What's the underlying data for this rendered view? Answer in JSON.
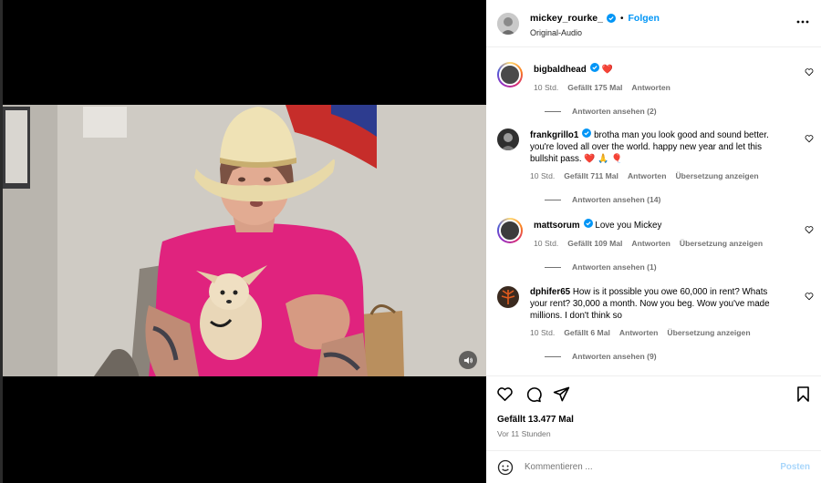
{
  "post": {
    "username": "mickey_rourke_",
    "separator": "•",
    "follow_label": "Folgen",
    "audio": "Original-Audio"
  },
  "comments": [
    {
      "username": "bigbaldhead",
      "text": "",
      "emoji": "❤️",
      "age": "10 Std.",
      "likes": "Gefällt 175 Mal",
      "reply": "Antworten",
      "translate": "",
      "view_replies": "Antworten ansehen (2)"
    },
    {
      "username": "frankgrillo1",
      "text": "brotha man you look good and sound better. you're loved all over the world. happy new year and let this bullshit pass.",
      "emoji": "❤️ 🙏 🎈",
      "age": "10 Std.",
      "likes": "Gefällt 711 Mal",
      "reply": "Antworten",
      "translate": "Übersetzung anzeigen",
      "view_replies": "Antworten ansehen (14)"
    },
    {
      "username": "mattsorum",
      "text": "Love you Mickey",
      "emoji": "",
      "age": "10 Std.",
      "likes": "Gefällt 109 Mal",
      "reply": "Antworten",
      "translate": "Übersetzung anzeigen",
      "view_replies": "Antworten ansehen (1)"
    },
    {
      "username": "dphifer65",
      "text": "How is it possible you owe 60,000 in rent? Whats your rent? 30,000 a month. Now you beg. Wow you've made millions. I don't think so",
      "emoji": "",
      "age": "10 Std.",
      "likes": "Gefällt 6 Mal",
      "reply": "Antworten",
      "translate": "Übersetzung anzeigen",
      "view_replies": "Antworten ansehen (9)"
    }
  ],
  "footer": {
    "likes": "Gefällt 13.477 Mal",
    "time": "Vor 11 Stunden",
    "comment_placeholder": "Kommentieren ...",
    "post_label": "Posten"
  },
  "colors": {
    "accent": "#0095f6",
    "verified": "#0095f6",
    "like_heart": "#ed4956",
    "post_disabled": "#a8d6fb",
    "shirt": "#e0237e"
  },
  "icons": [
    "audio-icon",
    "more-options-icon",
    "verified-icon",
    "heart-icon",
    "comment-icon",
    "share-icon",
    "bookmark-icon",
    "emoji-icon"
  ]
}
